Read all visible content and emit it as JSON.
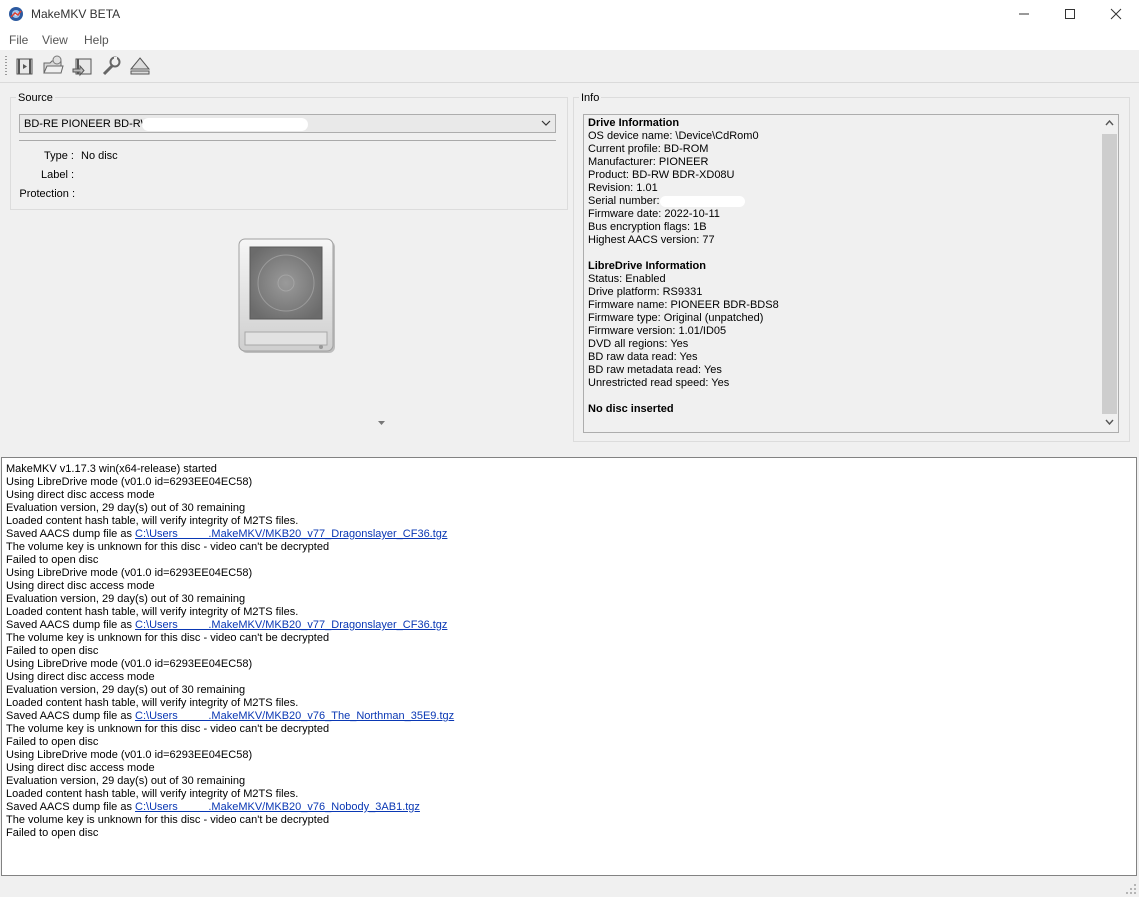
{
  "window": {
    "title": "MakeMKV BETA",
    "controls": [
      "minimize-icon",
      "maximize-icon",
      "close-icon"
    ]
  },
  "menu": {
    "items": [
      "File",
      "View",
      "Help"
    ]
  },
  "toolbar": {
    "buttons": [
      "open-files-icon",
      "open-disc-icon",
      "backup-icon",
      "preferences-icon",
      "eject-icon"
    ]
  },
  "source": {
    "group_title": "Source",
    "drive_selected": "BD-RE PIONEER BD-RW",
    "type_label": "Type :",
    "type_value": "No disc",
    "label_label": "Label :",
    "label_value": "",
    "protection_label": "Protection :",
    "protection_value": ""
  },
  "info": {
    "group_title": "Info",
    "lines": [
      {
        "text": "Drive Information",
        "bold": true
      },
      {
        "text": "OS device name: \\Device\\CdRom0"
      },
      {
        "text": "Current profile: BD-ROM"
      },
      {
        "text": "Manufacturer: PIONEER"
      },
      {
        "text": "Product: BD-RW BDR-XD08U"
      },
      {
        "text": "Revision: 1.01"
      },
      {
        "text": "Serial number:",
        "redacted": true
      },
      {
        "text": "Firmware date: 2022-10-11"
      },
      {
        "text": "Bus encryption flags: 1B"
      },
      {
        "text": "Highest AACS version: 77"
      },
      {
        "text": ""
      },
      {
        "text": "LibreDrive Information",
        "bold": true
      },
      {
        "text": "Status: Enabled"
      },
      {
        "text": "Drive platform: RS9331"
      },
      {
        "text": "Firmware name: PIONEER BDR-BDS8"
      },
      {
        "text": "Firmware type: Original (unpatched)"
      },
      {
        "text": "Firmware version: 1.01/ID05"
      },
      {
        "text": "DVD all regions: Yes"
      },
      {
        "text": "BD raw data read: Yes"
      },
      {
        "text": "BD raw metadata read: Yes"
      },
      {
        "text": "Unrestricted read speed: Yes"
      },
      {
        "text": ""
      },
      {
        "text": "No disc inserted",
        "bold": true
      }
    ]
  },
  "log": {
    "lines": [
      {
        "text": "MakeMKV v1.17.3 win(x64-release) started"
      },
      {
        "text": "Using LibreDrive mode (v01.0 id=6293EE04EC58)"
      },
      {
        "text": "Using direct disc access mode"
      },
      {
        "text": "Evaluation version, 29 day(s) out of 30 remaining"
      },
      {
        "text": "Loaded content hash table, will verify integrity of M2TS files."
      },
      {
        "text": "Saved AACS dump file as ",
        "link": "C:\\Users          .MakeMKV/MKB20_v77_Dragonslayer_CF36.tgz"
      },
      {
        "text": "The volume key is unknown for this disc - video can't be decrypted"
      },
      {
        "text": "Failed to open disc"
      },
      {
        "text": "Using LibreDrive mode (v01.0 id=6293EE04EC58)"
      },
      {
        "text": "Using direct disc access mode"
      },
      {
        "text": "Evaluation version, 29 day(s) out of 30 remaining"
      },
      {
        "text": "Loaded content hash table, will verify integrity of M2TS files."
      },
      {
        "text": "Saved AACS dump file as ",
        "link": "C:\\Users          .MakeMKV/MKB20_v77_Dragonslayer_CF36.tgz"
      },
      {
        "text": "The volume key is unknown for this disc - video can't be decrypted"
      },
      {
        "text": "Failed to open disc"
      },
      {
        "text": "Using LibreDrive mode (v01.0 id=6293EE04EC58)"
      },
      {
        "text": "Using direct disc access mode"
      },
      {
        "text": "Evaluation version, 29 day(s) out of 30 remaining"
      },
      {
        "text": "Loaded content hash table, will verify integrity of M2TS files."
      },
      {
        "text": "Saved AACS dump file as ",
        "link": "C:\\Users          .MakeMKV/MKB20_v76_The_Northman_35E9.tgz"
      },
      {
        "text": "The volume key is unknown for this disc - video can't be decrypted"
      },
      {
        "text": "Failed to open disc"
      },
      {
        "text": "Using LibreDrive mode (v01.0 id=6293EE04EC58)"
      },
      {
        "text": "Using direct disc access mode"
      },
      {
        "text": "Evaluation version, 29 day(s) out of 30 remaining"
      },
      {
        "text": "Loaded content hash table, will verify integrity of M2TS files."
      },
      {
        "text": "Saved AACS dump file as ",
        "link": "C:\\Users          .MakeMKV/MKB20_v76_Nobody_3AB1.tgz"
      },
      {
        "text": "The volume key is unknown for this disc - video can't be decrypted"
      },
      {
        "text": "Failed to open disc"
      }
    ]
  },
  "colors": {
    "link": "#0a38b4",
    "window_bg": "#f0f0f0",
    "log_bg": "#ffffff"
  }
}
